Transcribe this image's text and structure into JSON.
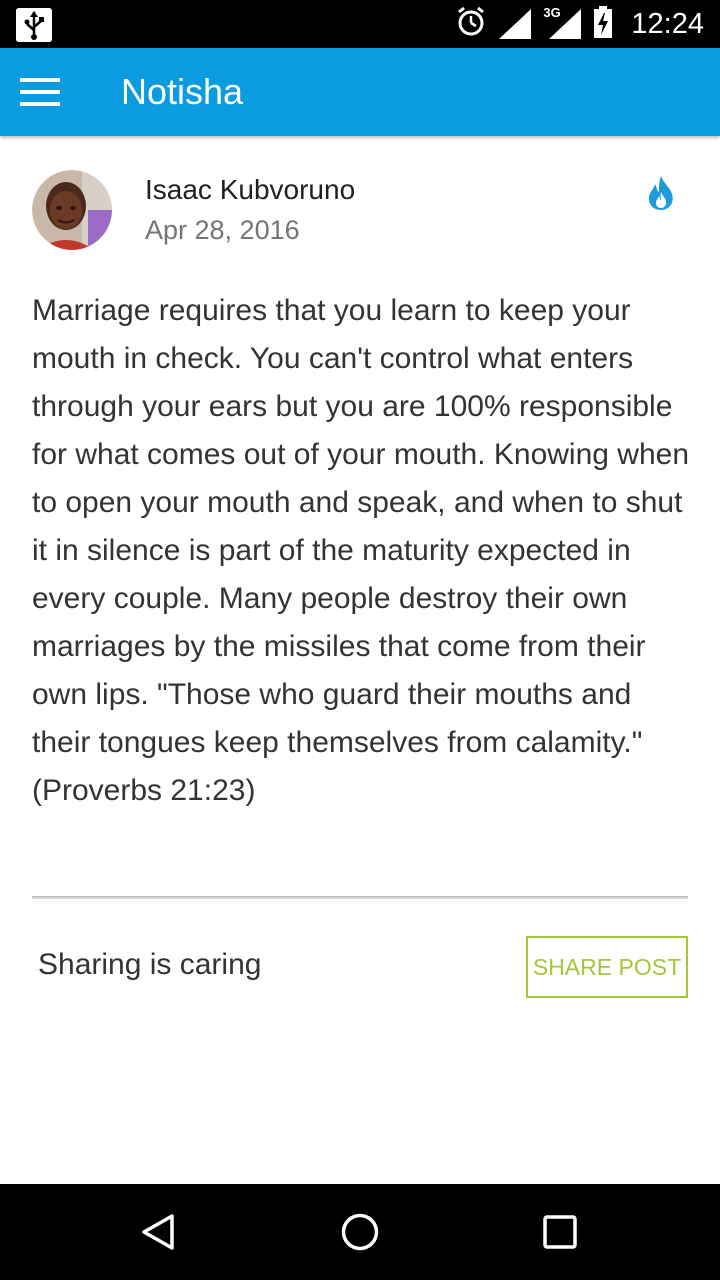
{
  "status_bar": {
    "time": "12:24",
    "network": "3G",
    "icons": [
      "usb-icon",
      "alarm-icon",
      "signal-icon",
      "battery-charging-icon"
    ]
  },
  "app_bar": {
    "title": "Notisha",
    "menu_icon": "hamburger-menu-icon"
  },
  "post": {
    "author": "Isaac Kubvoruno",
    "date": "Apr 28, 2016",
    "badge_icon": "fire-icon",
    "badge_color": "#1e9bdc",
    "body": "Marriage requires that you learn to keep your mouth in check. You can't control what enters through your ears but you are 100% responsible for what comes out of your mouth. Knowing when to open your mouth and speak, and when to shut it in silence is part of the maturity expected in every couple. Many people destroy their own marriages by the missiles that come from their own lips. \"Those who guard their mouths and their tongues keep themselves from calamity.\" (Proverbs 21:23)"
  },
  "share": {
    "text": "Sharing is caring",
    "button_label": "SHARE POST",
    "accent_color": "#a4c639"
  },
  "colors": {
    "app_bar": "#0a9be0",
    "status_bar": "#000000",
    "nav_bar": "#000000"
  },
  "nav_bar": {
    "buttons": [
      "back-icon",
      "home-icon",
      "recents-icon"
    ]
  }
}
